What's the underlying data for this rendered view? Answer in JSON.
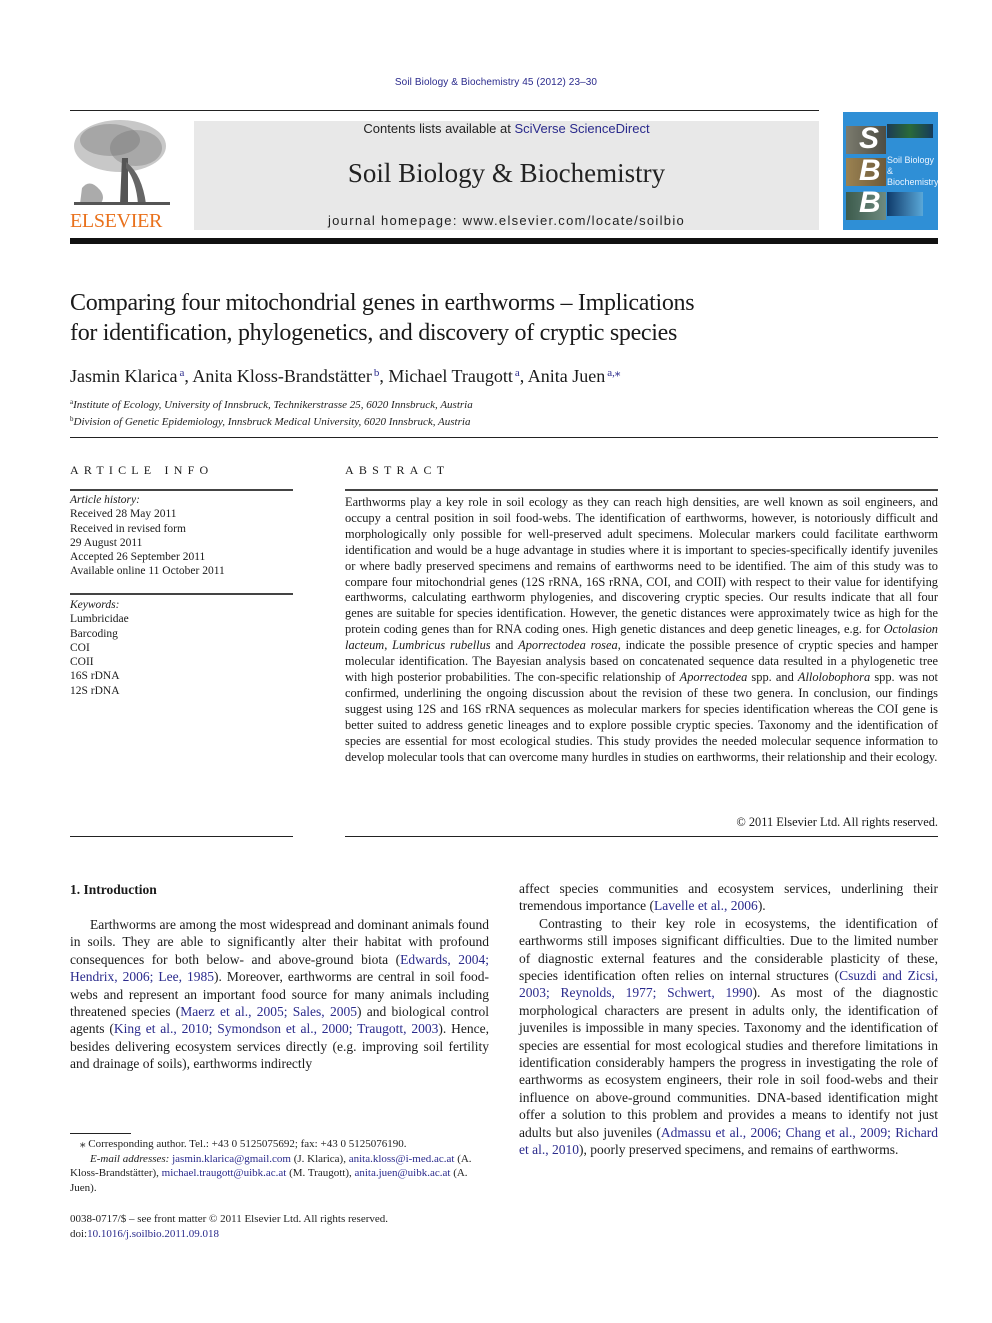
{
  "header": {
    "journal_ref": "Soil Biology & Biochemistry 45 (2012) 23–30",
    "contents_prefix": "Contents lists available at ",
    "contents_link": "SciVerse ScienceDirect",
    "journal_title": "Soil Biology & Biochemistry",
    "homepage_prefix": "journal homepage: ",
    "homepage_url": "www.elsevier.com/locate/soilbio",
    "publisher_wordmark": "ELSEVIER",
    "cover": {
      "letters": [
        "S",
        "B",
        "B"
      ],
      "title_line1": "Soil Biology &",
      "title_line2": "Biochemistry",
      "background_color": "#2f8fd6"
    }
  },
  "article": {
    "title_line1": "Comparing four mitochondrial genes in earthworms – Implications",
    "title_line2": "for identification, phylogenetics, and discovery of cryptic species",
    "authors": [
      {
        "name": "Jasmin Klarica",
        "sup": "a",
        "sep": ", "
      },
      {
        "name": "Anita Kloss-Brandstätter",
        "sup": "b",
        "sep": ", "
      },
      {
        "name": "Michael Traugott",
        "sup": "a",
        "sep": ", "
      },
      {
        "name": "Anita Juen",
        "sup": "a,⁎",
        "sep": ""
      }
    ],
    "affiliations": [
      {
        "sup": "a",
        "text": "Institute of Ecology, University of Innsbruck, Technikerstrasse 25, 6020 Innsbruck, Austria"
      },
      {
        "sup": "b",
        "text": "Division of Genetic Epidemiology, Innsbruck Medical University, 6020 Innsbruck, Austria"
      }
    ]
  },
  "article_info": {
    "heading": "ARTICLE INFO",
    "history_label": "Article history:",
    "history": [
      "Received 28 May 2011",
      "Received in revised form",
      "29 August 2011",
      "Accepted 26 September 2011",
      "Available online 11 October 2011"
    ],
    "keywords_label": "Keywords:",
    "keywords": [
      "Lumbricidae",
      "Barcoding",
      "COI",
      "COII",
      "16S rDNA",
      "12S rDNA"
    ]
  },
  "abstract": {
    "heading": "ABSTRACT",
    "p1": "Earthworms play a key role in soil ecology as they can reach high densities, are well known as soil engineers, and occupy a central position in soil food-webs. The identification of earthworms, however, is notoriously difficult and morphologically only possible for well-preserved adult specimens. Molecular markers could facilitate earthworm identification and would be a huge advantage in studies where it is important to species-specifically identify juveniles or where badly preserved specimens and remains of earthworms need to be identified. The aim of this study was to compare four mitochondrial genes (12S rRNA, 16S rRNA, COI, and COII) with respect to their value for identifying earthworms, calculating earthworm phylogenies, and discovering cryptic species. Our results indicate that all four genes are suitable for species identification. However, the genetic distances were approximately twice as high for the protein coding genes than for RNA coding ones. High genetic distances and deep genetic lineages, e.g. for ",
    "sp1": "Octolasion lacteum",
    "p2": ", ",
    "sp2": "Lumbricus rubellus",
    "p3": " and ",
    "sp3": "Aporrectodea rosea",
    "p4": ", indicate the possible presence of cryptic species and hamper molecular identification. The Bayesian analysis based on concatenated sequence data resulted in a phylogenetic tree with high posterior probabilities. The con-specific rela­tionship of ",
    "sp4": "Aporrectodea",
    "p5": " spp. and ",
    "sp5": "Allolobophora",
    "p6": " spp. was not confirmed, underlining the ongoing discussion about the revision of these two genera. In conclusion, our findings suggest using 12S and 16S rRNA sequences as molecular markers for species identification whereas the COI gene is better suited to address genetic lineages and to explore possible cryptic species. Taxonomy and the identification of species are essential for most ecological studies. This study provides the needed molecular sequence information to develop molecular tools that can overcome many hurdles in studies on earthworms, their relationship and their ecology.",
    "copyright": "© 2011 Elsevier Ltd. All rights reserved."
  },
  "introduction": {
    "heading": "1.  Introduction",
    "left": {
      "t1": "Earthworms are among the most widespread and dominant animals found in soils. They are able to significantly alter their habitat with profound consequences for both below- and above-ground biota (",
      "c1": "Edwards, 2004; Hendrix, 2006; Lee, 1985",
      "t2": "). More­over, earthworms are central in soil food-webs and represent an important food source for many animals including threatened species (",
      "c2": "Maerz et al., 2005; Sales, 2005",
      "t3": ") and biological control agents (",
      "c3": "King et al., 2010; Symondson et al., 2000; Traugott, 2003",
      "t4": "). Hence, besides delivering ecosystem services directly (e.g. improving soil fertility and drainage of soils), earthworms indirectly"
    },
    "right": {
      "t1": "affect species communities and ecosystem services, underlining their tremendous importance (",
      "c1": "Lavelle et al., 2006",
      "t2": ").",
      "t3": "Contrasting to their key role in ecosystems, the identification of earthworms still imposes significant difficulties. Due to the limited number of diagnostic external features and the considerable plas­ticity of these, species identification often relies on internal struc­tures (",
      "c2": "Csuzdi and Zicsi, 2003; Reynolds, 1977; Schwert, 1990",
      "t4": "). As most of the diagnostic morphological characters are present in adults only, the identification of juveniles is impossible in many species. Taxonomy and the identification of species are essential for most ecological studies and therefore limitations in identification considerably hampers the progress in investigating the role of earthworms as ecosystem engineers, their role in soil food-webs and their influence on above-ground communities. DNA-based identification might offer a solution to this problem and provides a means to identify not just adults but also juveniles (",
      "c3": "Admassu et al., 2006; Chang et al., 2009; Richard et al., 2010",
      "t5": "), poorly preserved specimens, and remains of earthworms."
    }
  },
  "footnotes": {
    "corresponding": "⁎ Corresponding author. Tel.: +43 0 5125075692; fax: +43 0 5125076190.",
    "email_label": "E-mail addresses:",
    "emails": [
      {
        "addr": "jasmin.klarica@gmail.com",
        "who": " (J. Klarica), "
      },
      {
        "addr": "anita.kloss@i-med.ac.at",
        "who": " (A. Kloss-Brandstätter), "
      },
      {
        "addr": "michael.traugott@uibk.ac.at",
        "who": " (M. Traugott), "
      },
      {
        "addr": "anita.juen@uibk.ac.at",
        "who": " (A. Juen)."
      }
    ],
    "front_matter": "0038-0717/$ – see front matter © 2011 Elsevier Ltd. All rights reserved.",
    "doi_label": "doi:",
    "doi": "10.1016/j.soilbio.2011.09.018"
  }
}
